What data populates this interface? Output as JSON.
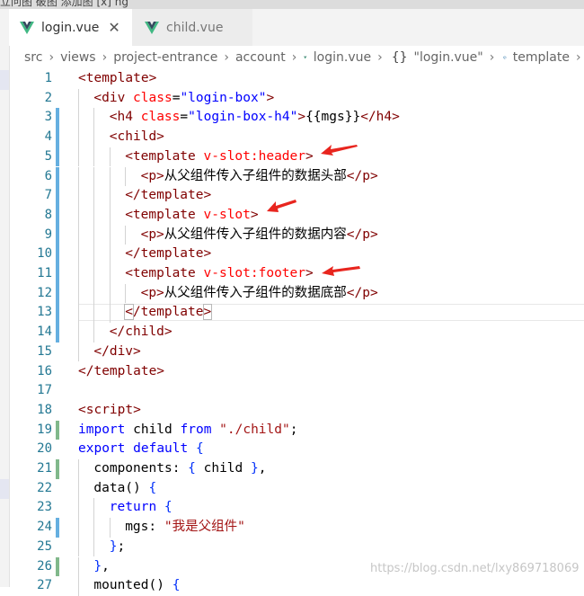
{
  "window": {
    "top_strip_text": "立问图    破图    添加图    [x]    ng"
  },
  "tabs": [
    {
      "label": "login.vue",
      "active": true
    },
    {
      "label": "child.vue",
      "active": false
    }
  ],
  "breadcrumb": {
    "items": [
      "src",
      "views",
      "project-entrance",
      "account",
      "login.vue",
      "\"login.vue\"",
      "template"
    ],
    "braces": "{}"
  },
  "code_lines": [
    {
      "n": "1",
      "segs": [
        {
          "c": "t-tag",
          "t": "<template>"
        }
      ]
    },
    {
      "n": "2",
      "segs": [
        {
          "c": "t-tag",
          "t": "<div"
        },
        {
          "c": "t-def",
          "t": " "
        },
        {
          "c": "t-attr",
          "t": "class"
        },
        {
          "c": "t-def",
          "t": "="
        },
        {
          "c": "t-str",
          "t": "\"login-box\""
        },
        {
          "c": "t-tag",
          "t": ">"
        }
      ]
    },
    {
      "n": "3",
      "segs": [
        {
          "c": "t-tag",
          "t": "<h4"
        },
        {
          "c": "t-def",
          "t": " "
        },
        {
          "c": "t-attr",
          "t": "class"
        },
        {
          "c": "t-def",
          "t": "="
        },
        {
          "c": "t-str",
          "t": "\"login-box-h4\""
        },
        {
          "c": "t-tag",
          "t": ">"
        },
        {
          "c": "t-def",
          "t": "{{mgs}}"
        },
        {
          "c": "t-tag",
          "t": "</h4>"
        }
      ]
    },
    {
      "n": "4",
      "segs": [
        {
          "c": "t-tag",
          "t": "<child>"
        }
      ]
    },
    {
      "n": "5",
      "segs": [
        {
          "c": "t-tag",
          "t": "<template"
        },
        {
          "c": "t-def",
          "t": " "
        },
        {
          "c": "t-attr",
          "t": "v-slot:header"
        },
        {
          "c": "t-tag",
          "t": ">"
        }
      ]
    },
    {
      "n": "6",
      "segs": [
        {
          "c": "t-tag",
          "t": "<p>"
        },
        {
          "c": "t-def",
          "t": "从父组件传入子组件的数据头部"
        },
        {
          "c": "t-tag",
          "t": "</p>"
        }
      ]
    },
    {
      "n": "7",
      "segs": [
        {
          "c": "t-tag",
          "t": "</template>"
        }
      ]
    },
    {
      "n": "8",
      "segs": [
        {
          "c": "t-tag",
          "t": "<template"
        },
        {
          "c": "t-def",
          "t": " "
        },
        {
          "c": "t-attr",
          "t": "v-slot"
        },
        {
          "c": "t-tag",
          "t": ">"
        }
      ]
    },
    {
      "n": "9",
      "segs": [
        {
          "c": "t-tag",
          "t": "<p>"
        },
        {
          "c": "t-def",
          "t": "从父组件传入子组件的数据内容"
        },
        {
          "c": "t-tag",
          "t": "</p>"
        }
      ]
    },
    {
      "n": "10",
      "segs": [
        {
          "c": "t-tag",
          "t": "</template>"
        }
      ]
    },
    {
      "n": "11",
      "segs": [
        {
          "c": "t-tag",
          "t": "<template"
        },
        {
          "c": "t-def",
          "t": " "
        },
        {
          "c": "t-attr",
          "t": "v-slot:footer"
        },
        {
          "c": "t-tag",
          "t": ">"
        }
      ]
    },
    {
      "n": "12",
      "segs": [
        {
          "c": "t-tag",
          "t": "<p>"
        },
        {
          "c": "t-def",
          "t": "从父组件传入子组件的数据底部"
        },
        {
          "c": "t-tag",
          "t": "</p>"
        }
      ]
    },
    {
      "n": "13",
      "segs": [
        {
          "c": "t-tag t-bm",
          "t": "<"
        },
        {
          "c": "t-tag",
          "t": "/template"
        },
        {
          "c": "t-tag t-bm",
          "t": ">"
        }
      ]
    },
    {
      "n": "14",
      "segs": [
        {
          "c": "t-tag",
          "t": "</child>"
        }
      ]
    },
    {
      "n": "15",
      "segs": [
        {
          "c": "t-tag",
          "t": "</div>"
        }
      ]
    },
    {
      "n": "16",
      "segs": [
        {
          "c": "t-tag",
          "t": "</template>"
        }
      ]
    },
    {
      "n": "17",
      "segs": []
    },
    {
      "n": "18",
      "segs": [
        {
          "c": "t-tag",
          "t": "<script>"
        }
      ]
    },
    {
      "n": "19",
      "segs": [
        {
          "c": "t-kw",
          "t": "import"
        },
        {
          "c": "t-def",
          "t": " child "
        },
        {
          "c": "t-kw",
          "t": "from"
        },
        {
          "c": "t-def",
          "t": " "
        },
        {
          "c": "t-strb",
          "t": "\"./child\""
        },
        {
          "c": "t-def",
          "t": ";"
        }
      ]
    },
    {
      "n": "20",
      "segs": [
        {
          "c": "t-kw",
          "t": "export"
        },
        {
          "c": "t-def",
          "t": " "
        },
        {
          "c": "t-kw",
          "t": "default"
        },
        {
          "c": "t-def",
          "t": " "
        },
        {
          "c": "t-brace",
          "t": "{"
        }
      ]
    },
    {
      "n": "21",
      "segs": [
        {
          "c": "t-def",
          "t": "components: "
        },
        {
          "c": "t-brace",
          "t": "{"
        },
        {
          "c": "t-def",
          "t": " child "
        },
        {
          "c": "t-brace",
          "t": "}"
        },
        {
          "c": "t-def",
          "t": ","
        }
      ]
    },
    {
      "n": "22",
      "segs": [
        {
          "c": "t-def",
          "t": "data() "
        },
        {
          "c": "t-brace",
          "t": "{"
        }
      ]
    },
    {
      "n": "23",
      "segs": [
        {
          "c": "t-kw",
          "t": "return"
        },
        {
          "c": "t-def",
          "t": " "
        },
        {
          "c": "t-brace",
          "t": "{"
        }
      ]
    },
    {
      "n": "24",
      "segs": [
        {
          "c": "t-def",
          "t": "mgs: "
        },
        {
          "c": "t-strb",
          "t": "\"我是父组件\""
        }
      ]
    },
    {
      "n": "25",
      "segs": [
        {
          "c": "t-brace",
          "t": "}"
        },
        {
          "c": "t-def",
          "t": ";"
        }
      ]
    },
    {
      "n": "26",
      "segs": [
        {
          "c": "t-brace",
          "t": "}"
        },
        {
          "c": "t-def",
          "t": ","
        }
      ]
    },
    {
      "n": "27",
      "segs": [
        {
          "c": "t-def",
          "t": "mounted() "
        },
        {
          "c": "t-brace",
          "t": "{"
        }
      ]
    }
  ],
  "watermark": "https://blog.csdn.net/lxy869718069",
  "colors": {
    "tag": "#800000",
    "attribute": "#ff0000",
    "attr_value": "#0000ff",
    "keyword": "#0000ff",
    "string": "#a31515",
    "line_number": "#237893",
    "gutter_modified": "#66afe0",
    "gutter_added": "#81b88b",
    "annotation_arrow": "#e8251e",
    "vue_logo_green": "#41b883",
    "vue_logo_dark": "#35495e"
  }
}
